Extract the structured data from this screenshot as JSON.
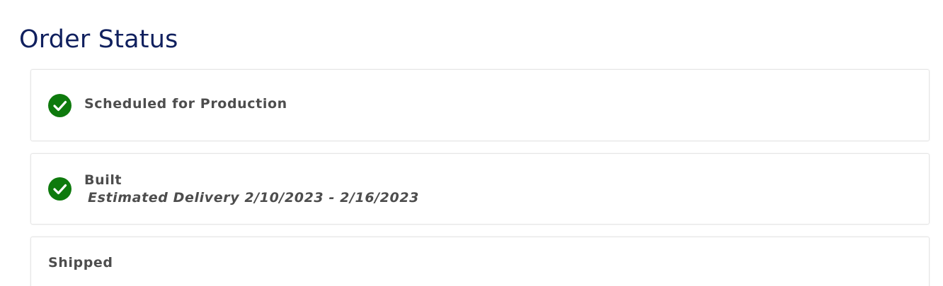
{
  "page": {
    "title": "Order Status"
  },
  "steps": [
    {
      "label": "Scheduled for Production",
      "completed": true,
      "icon": "check-circle-icon"
    },
    {
      "label": "Built",
      "subtext": "Estimated Delivery 2/10/2023 - 2/16/2023",
      "completed": true,
      "icon": "check-circle-icon"
    },
    {
      "label": "Shipped",
      "completed": false
    }
  ],
  "colors": {
    "title": "#10205e",
    "check": "#0e7a0d",
    "text": "#4d4d4d",
    "card_border": "#e6e6e6"
  }
}
